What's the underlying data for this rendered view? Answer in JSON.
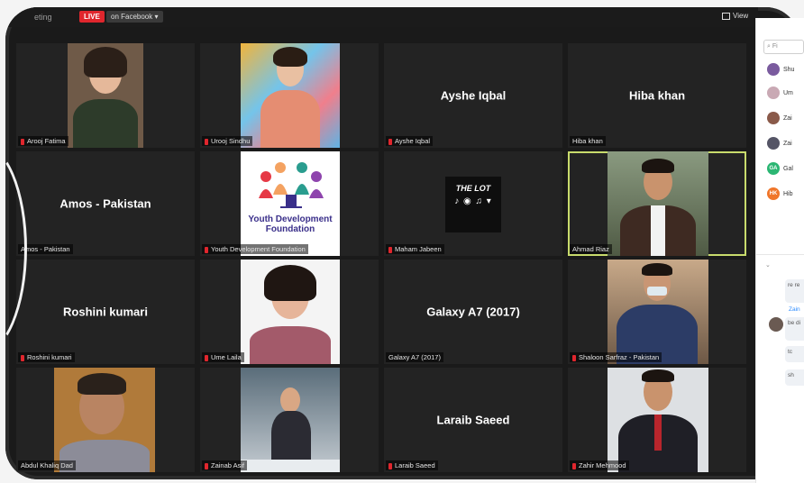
{
  "topbar": {
    "meeting_name": "eting",
    "live_label": "LIVE",
    "live_destination": "on Facebook ▾",
    "view_label": "View"
  },
  "tiles": [
    {
      "name": "Arooj Fatima"
    },
    {
      "name": "Urooj Sindhu"
    },
    {
      "name": "Ayshe Iqbal",
      "center": "Ayshe Iqbal"
    },
    {
      "name": "Hiba khan",
      "center": "Hiba khan"
    },
    {
      "name": "Amos - Pakistan",
      "center": "Amos - Pakistan"
    },
    {
      "name": "Youth Development Foundation",
      "logo_text": "Youth Development Foundation"
    },
    {
      "name": "Maham Jabeen",
      "logo_title": "THE LOT"
    },
    {
      "name": "Ahmad Riaz"
    },
    {
      "name": "Roshini kumari",
      "center": "Roshini kumari"
    },
    {
      "name": "Ume Laila"
    },
    {
      "name": "Galaxy A7 (2017)",
      "center": "Galaxy A7 (2017)"
    },
    {
      "name": "Shaloon Sarfraz - Pakistan"
    },
    {
      "name": "Abdul Khaliq Dad"
    },
    {
      "name": "Zainab Asif"
    },
    {
      "name": "Laraib Saeed",
      "center": "Laraib Saeed"
    },
    {
      "name": "Zahir Mehmood"
    }
  ],
  "sidebar": {
    "search_placeholder": "Fi",
    "participants": [
      {
        "label": "Shu",
        "color": "#7a5b9e"
      },
      {
        "label": "Um",
        "color": "#c9a9b4"
      },
      {
        "label": "Zai",
        "color": "#8a5a4a"
      },
      {
        "label": "Zai",
        "color": "#556"
      },
      {
        "label": "Gal",
        "initials": "GA",
        "color": "#2bb673"
      },
      {
        "label": "Hib",
        "initials": "HK",
        "color": "#f0762a"
      }
    ],
    "chat": [
      "re re",
      "be di",
      "tc",
      "sh"
    ],
    "chat_sender": "Zain"
  }
}
